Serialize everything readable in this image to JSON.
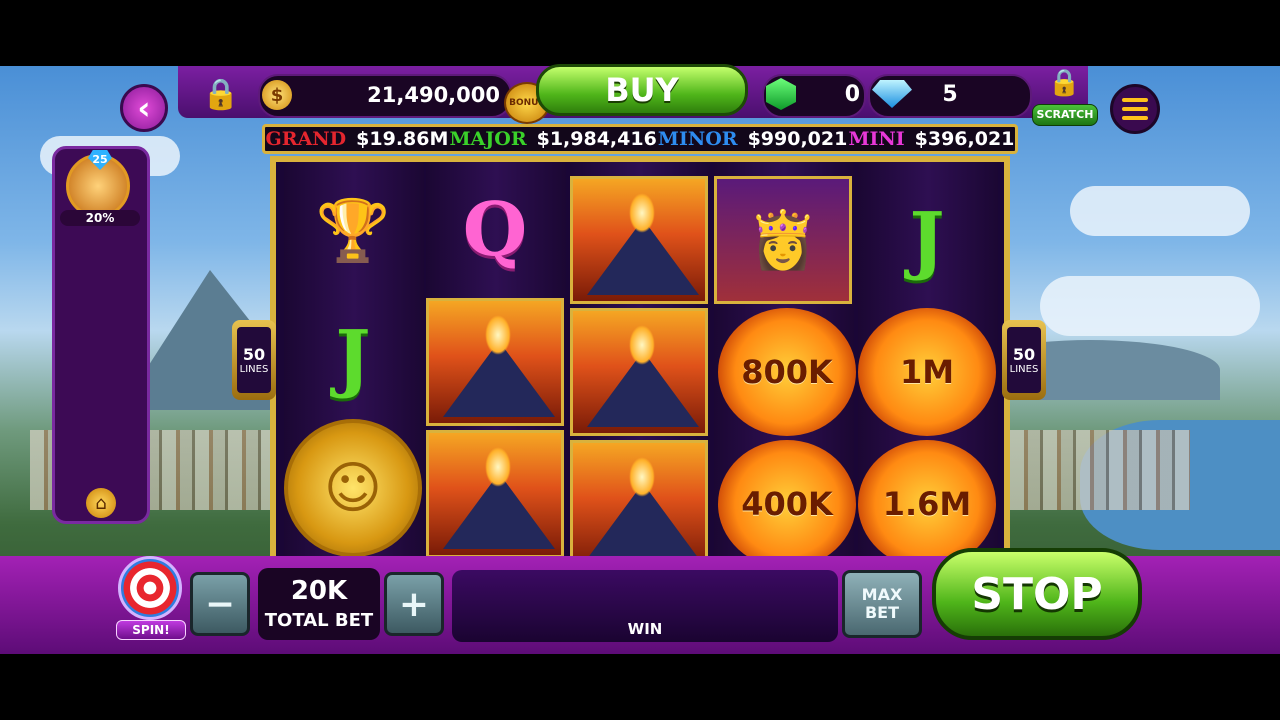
{
  "header": {
    "coins": "21,490,000",
    "coin_symbol": "$",
    "bonus_label": "BONUS",
    "buy_label": "BUY",
    "gems": "0",
    "diamonds": "5",
    "scratch_label": "SCRATCH",
    "back_symbol": "‹"
  },
  "jackpots": [
    {
      "name": "GRAND",
      "value": "$19.86M",
      "color": "#e4262e"
    },
    {
      "name": "MAJOR",
      "value": "$1,984,416",
      "color": "#3ad12a"
    },
    {
      "name": "MINOR",
      "value": "$990,021",
      "color": "#2e8cf0"
    },
    {
      "name": "MINI",
      "value": "$396,021",
      "color": "#e838d8"
    }
  ],
  "side": {
    "badge": "25",
    "progress": "20%"
  },
  "lines": {
    "count": "50",
    "label": "LINES"
  },
  "reels": {
    "r1": {
      "c1": "goblet",
      "c2": "J",
      "c3": "gold-coin"
    },
    "r2": {
      "c1": "Q",
      "c2": "volcano",
      "c3": "volcano"
    },
    "r3": {
      "c1": "volcano",
      "c2": "volcano",
      "c3": "volcano"
    },
    "r4": {
      "c1": "queen",
      "c2": "800K",
      "c3": "400K"
    },
    "r5": {
      "c1": "J",
      "c2": "1M",
      "c3": "1.6M"
    }
  },
  "bottom": {
    "spin_label": "SPIN!",
    "minus": "−",
    "plus": "+",
    "bet_value": "20K",
    "bet_label": "TOTAL BET",
    "win_label": "WIN",
    "maxbet_label": "MAX BET",
    "stop_label": "STOP"
  }
}
